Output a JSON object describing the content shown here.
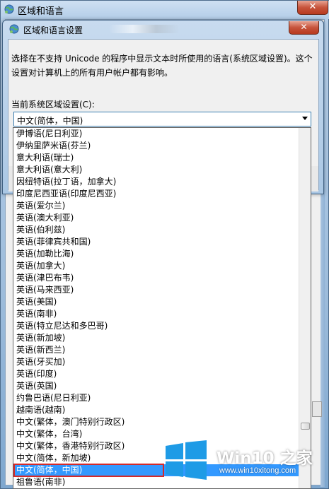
{
  "outer_window": {
    "title": "区域和语言",
    "close_label": "✕"
  },
  "dialog": {
    "title": "区域和语言设置",
    "close_label": "✕",
    "description": "选择在不支持 Unicode 的程序中显示文本时所使用的语言(系统区域设置)。这个设置对计算机上的所有用户帐户都有影响。",
    "locale_label": "当前系统区域设置(C):",
    "selected_locale": "中文(简体，中国)"
  },
  "dropdown": {
    "items": [
      "伊博语(尼日利亚)",
      "伊纳里萨米语(芬兰)",
      "意大利语(瑞士)",
      "意大利语(意大利)",
      "因纽特语(拉丁语，加拿大)",
      "印度尼西亚语(印度尼西亚)",
      "英语(爱尔兰)",
      "英语(澳大利亚)",
      "英语(伯利兹)",
      "英语(菲律宾共和国)",
      "英语(加勒比海)",
      "英语(加拿大)",
      "英语(津巴布韦)",
      "英语(马来西亚)",
      "英语(美国)",
      "英语(南非)",
      "英语(特立尼达和多巴哥)",
      "英语(新加坡)",
      "英语(新西兰)",
      "英语(牙买加)",
      "英语(印度)",
      "英语(英国)",
      "约鲁巴语(尼日利亚)",
      "越南语(越南)",
      "中文(繁体，澳门特别行政区)",
      "中文(繁体，台湾)",
      "中文(繁体，香港特别行政区)",
      "中文(简体，新加坡)",
      "中文(简体，中国)",
      "祖鲁语(南非)"
    ],
    "selected_index": 28
  },
  "watermark": {
    "brand": "Win10 之家",
    "url": "www.win10xitong.com"
  },
  "colors": {
    "selection": "#3399ff",
    "highlight_box": "#d42a2a"
  }
}
